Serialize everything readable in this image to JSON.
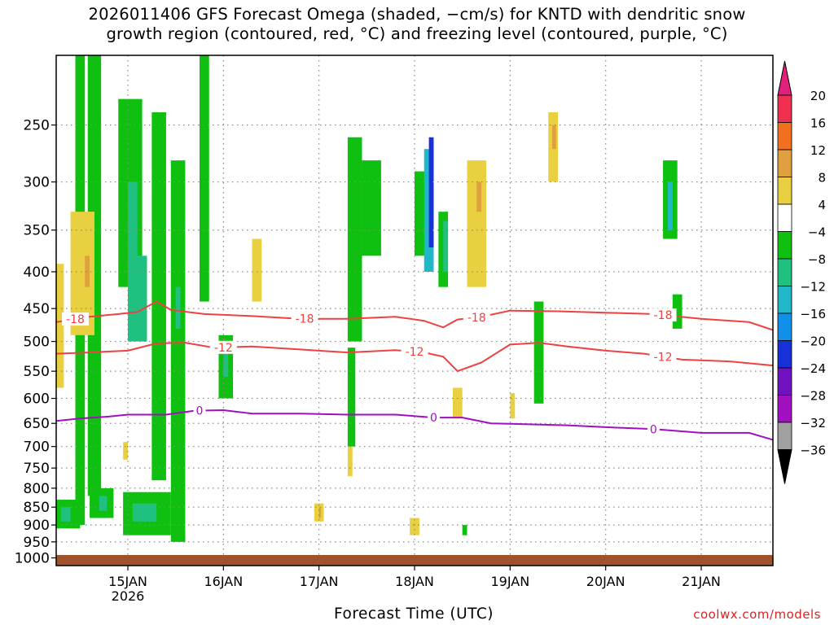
{
  "title": {
    "line1": "2026011406 GFS Forecast Omega (shaded, −cm/s) for KNTD with dendritic snow",
    "line2": "growth region (contoured, red, °C) and freezing level (contoured, purple, °C)"
  },
  "credit": "coolwx.com/models",
  "chart_data": {
    "type": "heatmap",
    "xlabel": "Forecast Time (UTC)",
    "ylabel": "",
    "x_ticks": [
      {
        "label": "15JAN",
        "sub": "2026",
        "t": 1.0
      },
      {
        "label": "16JAN",
        "sub": "",
        "t": 2.0
      },
      {
        "label": "17JAN",
        "sub": "",
        "t": 3.0
      },
      {
        "label": "18JAN",
        "sub": "",
        "t": 4.0
      },
      {
        "label": "19JAN",
        "sub": "",
        "t": 5.0
      },
      {
        "label": "20JAN",
        "sub": "",
        "t": 6.0
      },
      {
        "label": "21JAN",
        "sub": "",
        "t": 7.0
      }
    ],
    "xlim_days_from_14jan": [
      0.25,
      7.75
    ],
    "y_ticks": [
      250,
      300,
      350,
      400,
      450,
      500,
      550,
      600,
      650,
      700,
      750,
      800,
      850,
      900,
      950,
      1000
    ],
    "ylim_hpa": [
      1025,
      200
    ],
    "y_scale": "log-pressure",
    "grid": true,
    "colorbar": {
      "labels": [
        "20",
        "16",
        "12",
        "8",
        "4",
        "−4",
        "−8",
        "−12",
        "−16",
        "−20",
        "−24",
        "−28",
        "−32",
        "−36"
      ],
      "colors": [
        "#f03050",
        "#f07020",
        "#e0a040",
        "#e8d040",
        "#ffffff",
        "#10c010",
        "#20c080",
        "#20b8c8",
        "#1090e8",
        "#1830d8",
        "#7010c0",
        "#a010c0",
        "#a0a0a0"
      ],
      "top_arrow_color": "#e0207a",
      "bottom_arrow_color": "#000000"
    },
    "contours": [
      {
        "series": "dendritic snow growth",
        "level": -18,
        "color": "#f04040",
        "points": [
          [
            0.25,
            470
          ],
          [
            0.6,
            462
          ],
          [
            0.9,
            458
          ],
          [
            1.1,
            455
          ],
          [
            1.3,
            440
          ],
          [
            1.45,
            452
          ],
          [
            1.8,
            458
          ],
          [
            2.3,
            461
          ],
          [
            2.8,
            465
          ],
          [
            3.3,
            465
          ],
          [
            3.8,
            462
          ],
          [
            4.1,
            468
          ],
          [
            4.3,
            478
          ],
          [
            4.45,
            466
          ],
          [
            4.7,
            462
          ],
          [
            5.0,
            453
          ],
          [
            5.5,
            454
          ],
          [
            6.0,
            456
          ],
          [
            6.5,
            458
          ],
          [
            7.0,
            465
          ],
          [
            7.5,
            470
          ],
          [
            7.75,
            482
          ]
        ],
        "labels": [
          [
            0.45,
            "-18"
          ],
          [
            2.85,
            "-18"
          ],
          [
            4.65,
            "-18"
          ],
          [
            6.6,
            "-18"
          ]
        ]
      },
      {
        "series": "dendritic snow growth",
        "level": -12,
        "color": "#f04040",
        "points": [
          [
            0.25,
            520
          ],
          [
            0.6,
            518
          ],
          [
            1.0,
            515
          ],
          [
            1.3,
            503
          ],
          [
            1.6,
            502
          ],
          [
            1.9,
            510
          ],
          [
            2.3,
            508
          ],
          [
            2.8,
            513
          ],
          [
            3.3,
            518
          ],
          [
            3.8,
            514
          ],
          [
            4.1,
            518
          ],
          [
            4.3,
            525
          ],
          [
            4.45,
            550
          ],
          [
            4.7,
            535
          ],
          [
            5.0,
            505
          ],
          [
            5.3,
            502
          ],
          [
            5.6,
            508
          ],
          [
            6.0,
            515
          ],
          [
            6.4,
            520
          ],
          [
            6.8,
            530
          ],
          [
            7.3,
            533
          ],
          [
            7.75,
            540
          ]
        ],
        "labels": [
          [
            2.0,
            "-12"
          ],
          [
            4.0,
            "-12"
          ],
          [
            6.6,
            "-12"
          ]
        ]
      },
      {
        "series": "freezing level",
        "level": 0,
        "color": "#a010c0",
        "points": [
          [
            0.25,
            645
          ],
          [
            0.5,
            640
          ],
          [
            0.8,
            636
          ],
          [
            1.0,
            632
          ],
          [
            1.4,
            632
          ],
          [
            1.7,
            624
          ],
          [
            2.0,
            623
          ],
          [
            2.3,
            630
          ],
          [
            2.8,
            630
          ],
          [
            3.3,
            632
          ],
          [
            3.8,
            632
          ],
          [
            4.2,
            638
          ],
          [
            4.5,
            638
          ],
          [
            4.8,
            650
          ],
          [
            5.2,
            652
          ],
          [
            5.6,
            654
          ],
          [
            6.0,
            658
          ],
          [
            6.5,
            662
          ],
          [
            7.0,
            670
          ],
          [
            7.5,
            670
          ],
          [
            7.75,
            685
          ]
        ],
        "labels": [
          [
            1.75,
            "0"
          ],
          [
            4.2,
            "0"
          ],
          [
            6.5,
            "0"
          ]
        ]
      }
    ]
  }
}
